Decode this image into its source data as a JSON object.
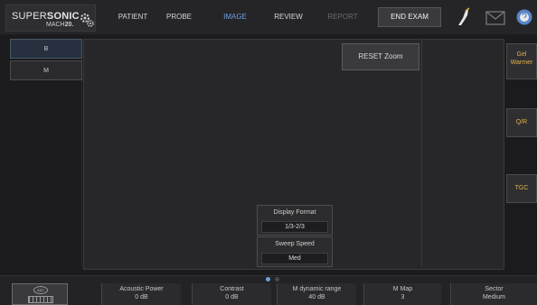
{
  "logo": {
    "brand_a": "SUPER",
    "brand_b": "SONIC",
    "model": "MACH",
    "model_num": "20."
  },
  "nav": {
    "patient": "PATIENT",
    "probe": "PROBE",
    "image": "IMAGE",
    "review": "REVIEW",
    "report": "REPORT",
    "end_exam": "END EXAM"
  },
  "icons": {
    "probe": "probe-hand-icon",
    "mail": "envelope-icon",
    "help": "help-icon"
  },
  "modes": {
    "b": "B",
    "m": "M"
  },
  "image": {
    "reset_zoom": "RESET Zoom"
  },
  "controls": {
    "display_format": {
      "label": "Display Format",
      "value": "1/3-2/3"
    },
    "sweep_speed": {
      "label": "Sweep Speed",
      "value": "Med"
    }
  },
  "side": {
    "gel_warmer": "Gel\nWarmer",
    "qr": "Q/R",
    "tgc": "TGC"
  },
  "bottom": {
    "kbd_label": "ABC",
    "params": [
      {
        "name": "Acoustic Power",
        "value": "0 dB"
      },
      {
        "name": "Contrast",
        "value": "0 dB"
      },
      {
        "name": "M dynamic range",
        "value": "40 dB"
      },
      {
        "name": "M Map",
        "value": "3"
      },
      {
        "name": "Sector",
        "value": "Medium"
      }
    ]
  },
  "colors": {
    "accent": "#6f9ede",
    "warm": "#e1b24a"
  }
}
